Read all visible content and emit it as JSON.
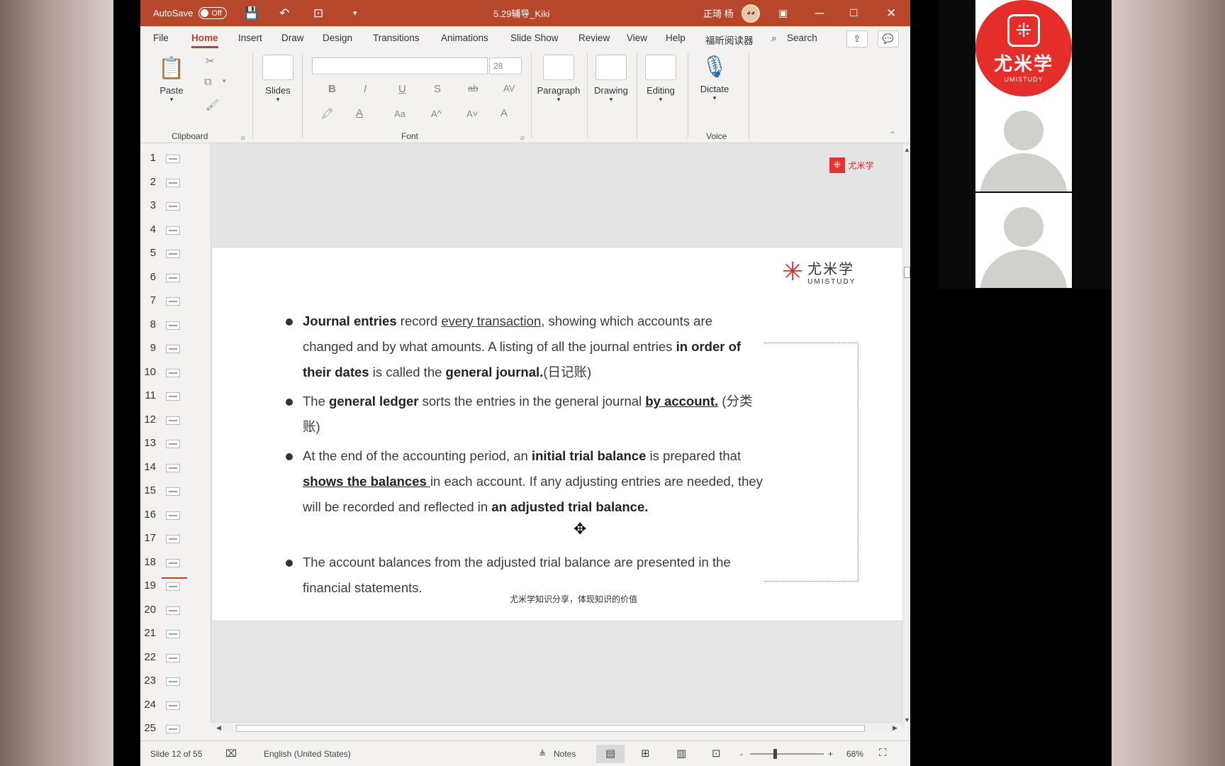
{
  "titlebar": {
    "autosave_label": "AutoSave",
    "autosave_state": "Off",
    "doc_title": "5.29辅导_Kiki",
    "user_name": "正琦 杨"
  },
  "menu": {
    "tabs": [
      "File",
      "Home",
      "Insert",
      "Draw",
      "Design",
      "Transitions",
      "Animations",
      "Slide Show",
      "Review",
      "View",
      "Help",
      "福昕阅读器"
    ],
    "search_label": "Search"
  },
  "ribbon": {
    "paste": "Paste",
    "clipboard": "Clipboard",
    "slides": "Slides",
    "font_size": "28",
    "font": "Font",
    "paragraph": "Paragraph",
    "drawing": "Drawing",
    "editing": "Editing",
    "dictate": "Dictate",
    "voice": "Voice",
    "font_glyphs": {
      "bold": "B",
      "italic": "I",
      "underline": "U",
      "shadow": "S",
      "strike": "ab",
      "spacing": "AV",
      "case": "Aa",
      "grow": "A^",
      "shrink": "A˅",
      "clear": "A"
    }
  },
  "thumbnails": [
    "1",
    "2",
    "3",
    "4",
    "5",
    "6",
    "7",
    "8",
    "9",
    "10",
    "11",
    "12",
    "13",
    "14",
    "15",
    "16",
    "17",
    "18",
    "19",
    "20",
    "21",
    "22",
    "23",
    "24",
    "25"
  ],
  "slide": {
    "logo_cn": "尤米学",
    "logo_en": "UMISTUDY",
    "footer": "尤米学知识分享，体现知识的价值",
    "bullets": {
      "b1": {
        "t1": "Journal entries",
        "t2": " record ",
        "t3": "every transaction",
        "t4": ", showing which accounts are changed and by what amounts. A listing of all the journal entries ",
        "t5": "in order of their dates",
        "t6": " is called the ",
        "t7": "general journal.",
        "t8": "(日记账)"
      },
      "b2": {
        "t1": "The ",
        "t2": "general ledger",
        "t3": " sorts the entries in the general journal ",
        "t4": "by account.",
        "t5": " (分类账)"
      },
      "b3": {
        "t1": "At the end of the accounting period, an ",
        "t2": "initial trial balance",
        "t3": " is prepared that ",
        "t4": "shows the balances ",
        "t5": "in each account. If any adjusting entries are needed, they will be recorded and reflected in ",
        "t6": "an adjusted trial balance."
      },
      "b4": {
        "t1": "The account balances from the adjusted trial balance are presented in the financial statements."
      }
    }
  },
  "statusbar": {
    "slide_indicator": "Slide 12 of 55",
    "language": "English (United States)",
    "notes": "Notes",
    "zoom": "68%",
    "zoom_minus": "-",
    "zoom_plus": "+"
  },
  "participants": {
    "presenter_logo_cn": "尤米学",
    "presenter_logo_en": "UMISTUDY"
  },
  "colors": {
    "ppt_accent": "#b7472a",
    "brand_red": "#e52e2a"
  }
}
